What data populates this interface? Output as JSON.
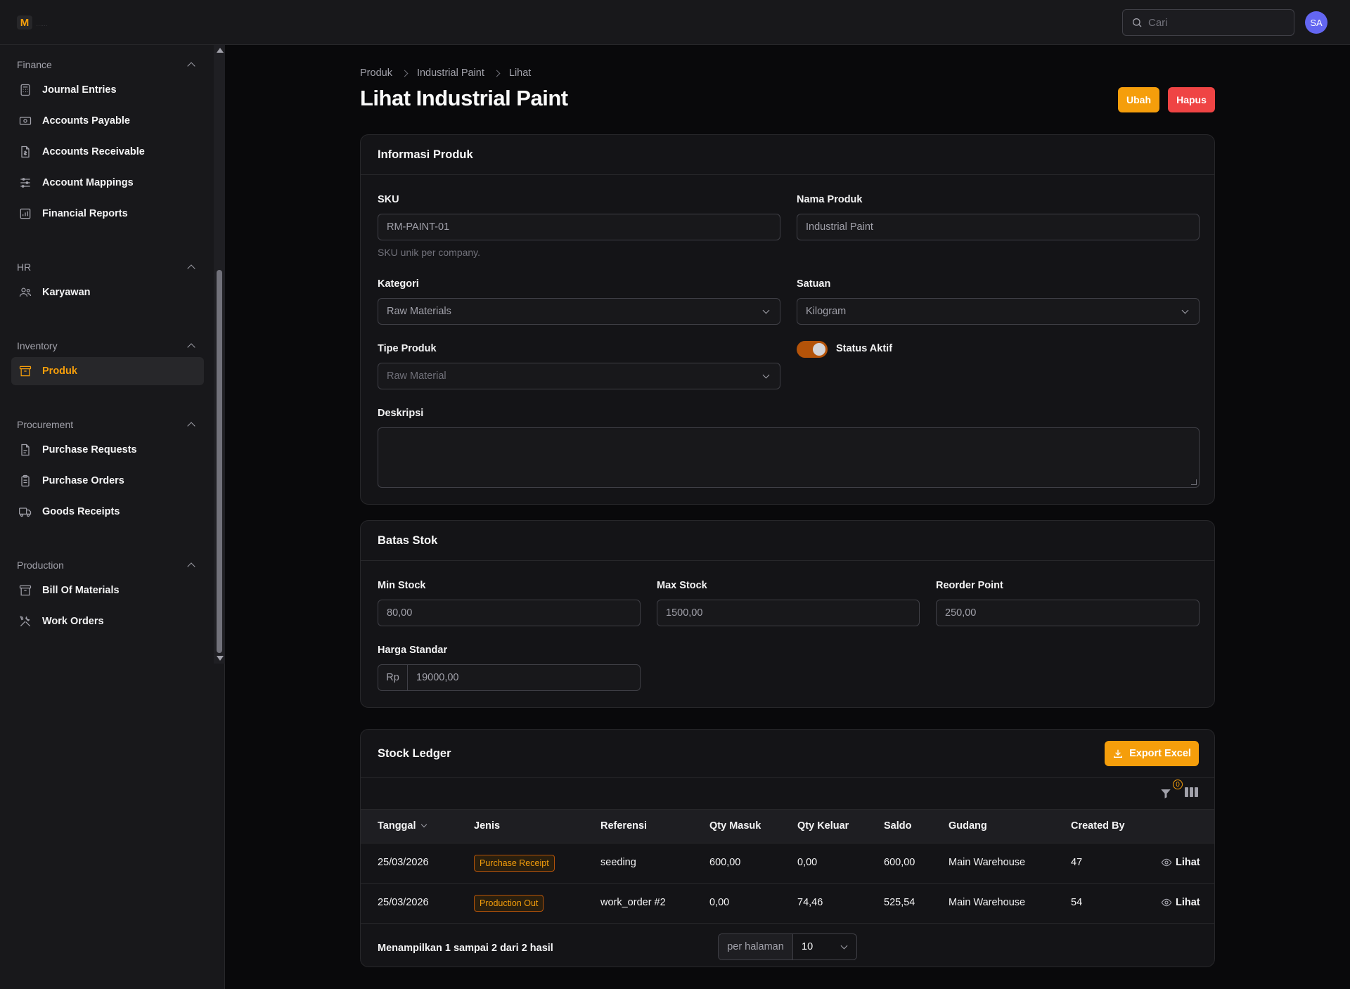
{
  "app": {
    "logo_letter": "M",
    "logo_sub": "......"
  },
  "topbar": {
    "search_placeholder": "Cari",
    "avatar_initials": "SA"
  },
  "sidebar": {
    "groups": [
      {
        "title": "Finance",
        "items": [
          {
            "label": "Journal Entries",
            "icon": "calculator-icon"
          },
          {
            "label": "Accounts Payable",
            "icon": "banknote-icon"
          },
          {
            "label": "Accounts Receivable",
            "icon": "document-dollar-icon"
          },
          {
            "label": "Account Mappings",
            "icon": "sliders-icon"
          },
          {
            "label": "Financial Reports",
            "icon": "chart-bar-icon"
          }
        ]
      },
      {
        "title": "HR",
        "items": [
          {
            "label": "Karyawan",
            "icon": "users-icon"
          }
        ]
      },
      {
        "title": "Inventory",
        "items": [
          {
            "label": "Produk",
            "icon": "archive-box-icon",
            "active": true
          }
        ]
      },
      {
        "title": "Procurement",
        "items": [
          {
            "label": "Purchase Requests",
            "icon": "document-text-icon"
          },
          {
            "label": "Purchase Orders",
            "icon": "clipboard-icon"
          },
          {
            "label": "Goods Receipts",
            "icon": "truck-icon"
          }
        ]
      },
      {
        "title": "Production",
        "items": [
          {
            "label": "Bill Of Materials",
            "icon": "archive-box-icon"
          },
          {
            "label": "Work Orders",
            "icon": "wrench-screwdriver-icon"
          }
        ]
      }
    ]
  },
  "breadcrumb": [
    "Produk",
    "Industrial Paint",
    "Lihat"
  ],
  "page": {
    "title": "Lihat Industrial Paint",
    "edit_label": "Ubah",
    "delete_label": "Hapus"
  },
  "info": {
    "title": "Informasi Produk",
    "sku_label": "SKU",
    "sku_value": "RM-PAINT-01",
    "sku_hint": "SKU unik per company.",
    "name_label": "Nama Produk",
    "name_value": "Industrial Paint",
    "category_label": "Kategori",
    "category_value": "Raw Materials",
    "unit_label": "Satuan",
    "unit_value": "Kilogram",
    "type_label": "Tipe Produk",
    "type_value": "Raw Material",
    "status_label": "Status Aktif",
    "status_on": true,
    "desc_label": "Deskripsi",
    "desc_value": ""
  },
  "stock_limits": {
    "title": "Batas Stok",
    "min_label": "Min Stock",
    "min_value": "80,00",
    "max_label": "Max Stock",
    "max_value": "1500,00",
    "reorder_label": "Reorder Point",
    "reorder_value": "250,00",
    "price_label": "Harga Standar",
    "price_prefix": "Rp",
    "price_value": "19000,00"
  },
  "ledger": {
    "title": "Stock Ledger",
    "export_label": "Export Excel",
    "filter_count": "0",
    "columns": [
      "Tanggal",
      "Jenis",
      "Referensi",
      "Qty Masuk",
      "Qty Keluar",
      "Saldo",
      "Gudang",
      "Created By"
    ],
    "rows": [
      {
        "date": "25/03/2026",
        "type": "Purchase Receipt",
        "ref": "seeding",
        "qty_in": "600,00",
        "qty_out": "0,00",
        "balance": "600,00",
        "warehouse": "Main Warehouse",
        "created_by": "47",
        "action": "Lihat"
      },
      {
        "date": "25/03/2026",
        "type": "Production Out",
        "ref": "work_order #2",
        "qty_in": "0,00",
        "qty_out": "74,46",
        "balance": "525,54",
        "warehouse": "Main Warehouse",
        "created_by": "54",
        "action": "Lihat"
      }
    ],
    "summary": "Menampilkan 1 sampai 2 dari 2 hasil",
    "per_page_label": "per halaman",
    "per_page_value": "10"
  },
  "colors": {
    "accent": "#f59e0b",
    "danger": "#ef4444",
    "avatar": "#6366f1"
  }
}
